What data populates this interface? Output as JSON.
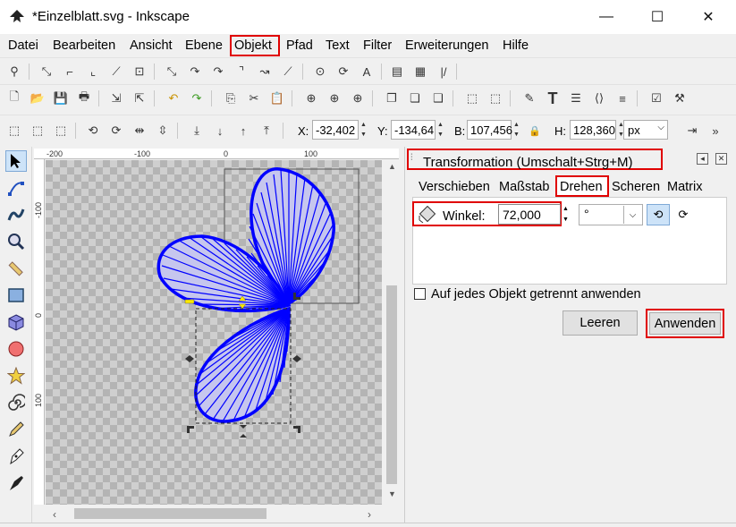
{
  "window": {
    "title": "*Einzelblatt.svg - Inkscape",
    "minimize_glyph": "—",
    "maximize_glyph": "☐",
    "close_glyph": "✕"
  },
  "menu": {
    "items": [
      "Datei",
      "Bearbeiten",
      "Ansicht",
      "Ebene",
      "Objekt",
      "Pfad",
      "Text",
      "Filter",
      "Erweiterungen",
      "Hilfe"
    ],
    "highlighted": "Objekt"
  },
  "coords_bar": {
    "x_label": "X:",
    "x_value": "-32,402",
    "y_label": "Y:",
    "y_value": "-134,64",
    "w_label": "B:",
    "w_value": "107,456",
    "h_label": "H:",
    "h_value": "128,360",
    "unit": "px"
  },
  "ruler": {
    "h_ticks": [
      "-200",
      "-100",
      "0",
      "100"
    ],
    "v_ticks": [
      "-100",
      "0",
      "100"
    ]
  },
  "dialog": {
    "title": "Transformation (Umschalt+Strg+M)",
    "tabs": [
      "Verschieben",
      "Maßstab",
      "Drehen",
      "Scheren",
      "Matrix"
    ],
    "active_tab": "Drehen",
    "angle_label": "Winkel:",
    "angle_value": "72,000",
    "angle_unit": "°",
    "apply_each_label": "Auf jedes Objekt getrennt anwenden",
    "apply_each_checked": false,
    "clear_button": "Leeren",
    "apply_button": "Anwenden"
  },
  "colors": {
    "highlight": "#e00000",
    "shape_stroke": "#0000ff",
    "canvas_dark": "#b4b4b4",
    "canvas_light": "#cfcfcf"
  }
}
